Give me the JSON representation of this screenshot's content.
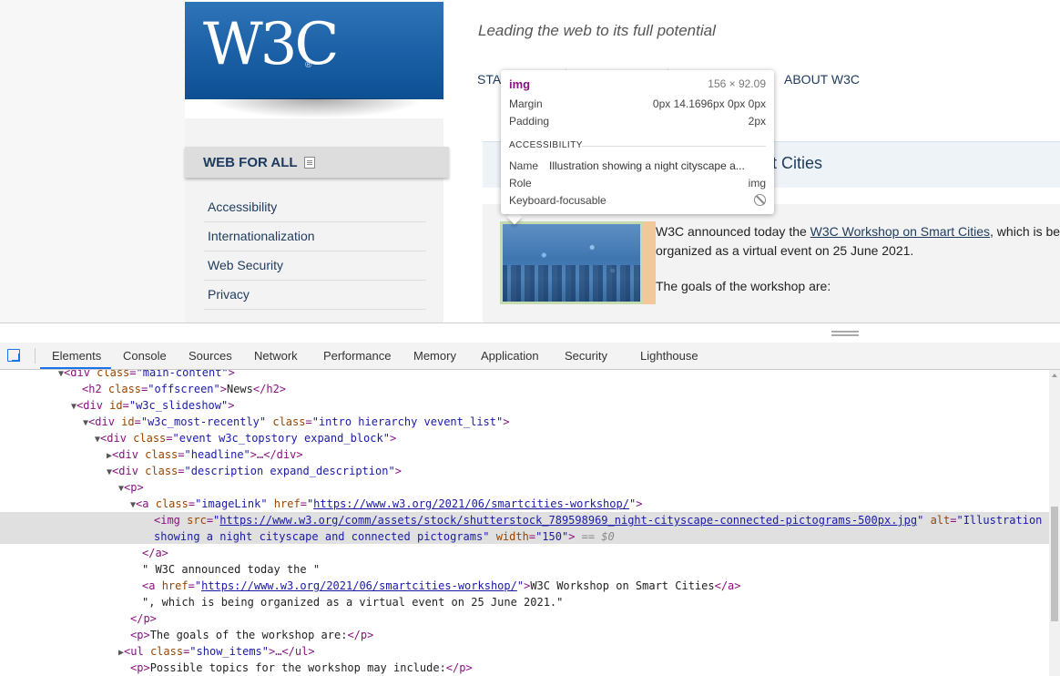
{
  "page": {
    "logo": {
      "text": "W3C",
      "reg": "®"
    },
    "tagline": "Leading the web to its full potential",
    "top_nav": {
      "first_partial": "STA",
      "about": "ABOUT W3C"
    },
    "sidebar": {
      "header": "WEB FOR ALL",
      "items": [
        "Accessibility",
        "Internationalization",
        "Web Security",
        "Privacy"
      ]
    },
    "news": {
      "headline_visible": "art Cities",
      "para1_before": "W3C announced today the ",
      "para1_link": "W3C Workshop on Smart Cities",
      "para1_after": ", which is be",
      "para1_line2": "organized as a virtual event on 25 June 2021.",
      "para2": "The goals of the workshop are:"
    },
    "image_alt": "Illustration showing a night cityscape and connected pictograms"
  },
  "tooltip": {
    "tag": "img",
    "dims": "156 × 92.09",
    "margin_label": "Margin",
    "margin_value": "0px 14.1696px 0px 0px",
    "padding_label": "Padding",
    "padding_value": "2px",
    "section": "ACCESSIBILITY",
    "name_label": "Name",
    "name_value": "Illustration showing a night cityscape a...",
    "role_label": "Role",
    "role_value": "img",
    "keyboard_label": "Keyboard-focusable"
  },
  "devtools": {
    "tabs": [
      "Elements",
      "Console",
      "Sources",
      "Network",
      "Performance",
      "Memory",
      "Application",
      "Security",
      "Lighthouse"
    ],
    "active_tab": "Elements",
    "tree": {
      "l0_tag": "<div ",
      "l0_an": "class",
      "l0_av": "\"main-content\"",
      "l1_tag": "<h2 ",
      "l1_an": "class",
      "l1_av": "\"offscreen\"",
      "l1_text": "News",
      "l1_close": "</h2>",
      "l2_tag": "<div ",
      "l2_an": "id",
      "l2_av": "\"w3c_slideshow\"",
      "l3_tag": "<div ",
      "l3_an1": "id",
      "l3_av1": "\"w3c_most-recently\"",
      "l3_an2": "class",
      "l3_av2": "\"intro hierarchy vevent_list\"",
      "l4_tag": "<div ",
      "l4_an": "class",
      "l4_av": "\"event w3c_topstory expand_block\"",
      "l5_tag": "<div ",
      "l5_an": "class",
      "l5_av": "\"headline\"",
      "l5_close": "…</div>",
      "l6_tag": "<div ",
      "l6_an": "class",
      "l6_av": "\"description expand_description\"",
      "l7_tag": "<p>",
      "l8_tag": "<a ",
      "l8_an1": "class",
      "l8_av1": "\"imageLink\"",
      "l8_an2": "href",
      "l8_link": "https://www.w3.org/2021/06/smartcities-workshop/",
      "l9_tag": "<img ",
      "l9_an1": "src",
      "l9_link": "https://www.w3.org/comm/assets/stock/shutterstock_789598969_night-cityscape-connected-pictograms-500px.jpg",
      "l9_an2": "alt",
      "l9_av2a": "\"Illustration",
      "l10_av2b": "showing a night cityscape and connected pictograms\"",
      "l10_an3": "width",
      "l10_av3": "\"150\"",
      "l10_eq": "== $0",
      "l11_tag": "</a>",
      "l12_text": "\" W3C announced today the \"",
      "l13_tag": "<a ",
      "l13_an": "href",
      "l13_link": "https://www.w3.org/2021/06/smartcities-workshop/",
      "l13_text": "W3C Workshop on Smart Cities",
      "l13_close": "</a>",
      "l14_text": "\", which is being organized as a virtual event on 25 June 2021.\"",
      "l15_tag": "</p>",
      "l16_open": "<p>",
      "l16_text": "The goals of the workshop are:",
      "l16_close": "</p>",
      "l17_tag": "<ul ",
      "l17_an": "class",
      "l17_av": "\"show_items\"",
      "l17_close": "…</ul>",
      "l18_open": "<p>",
      "l18_text": "Possible topics for the workshop may include:",
      "l18_close": "</p>"
    }
  },
  "colors": {
    "w3c_blue": "#1a5fa5",
    "tag": "#881280",
    "attr_name": "#994500",
    "attr_value": "#1a1aa6",
    "active_tab_underline": "#1a73e8"
  }
}
